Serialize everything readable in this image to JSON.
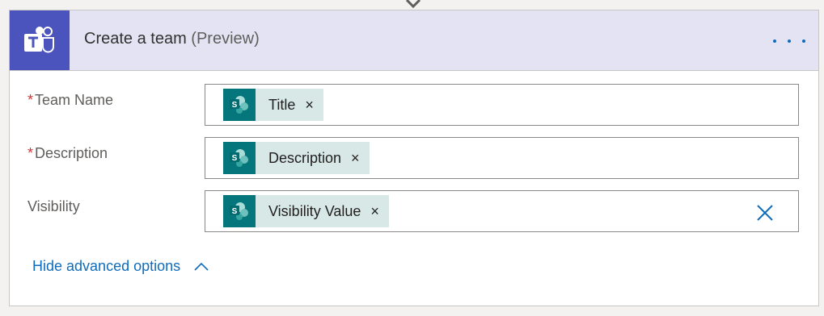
{
  "card": {
    "title": "Create a team",
    "title_suffix": "(Preview)",
    "app_icon": "microsoft-teams-icon",
    "more_icon": "more-options-icon"
  },
  "fields": [
    {
      "label": "Team Name",
      "required": true,
      "token": "Title",
      "token_icon": "sharepoint-icon",
      "remove_glyph": "×"
    },
    {
      "label": "Description",
      "required": true,
      "token": "Description",
      "token_icon": "sharepoint-icon",
      "remove_glyph": "×"
    },
    {
      "label": "Visibility",
      "required": false,
      "token": "Visibility Value",
      "token_icon": "sharepoint-icon",
      "remove_glyph": "×",
      "clear_icon": "clear-x-icon"
    }
  ],
  "required_marker": "*",
  "advanced": {
    "label": "Hide advanced options",
    "icon": "chevron-up-icon"
  },
  "colors": {
    "header_bg": "#e3e3f3",
    "teams_purple": "#4b53bc",
    "sharepoint_teal": "#05767b",
    "token_bg": "#d7e8e7",
    "link_blue": "#0f6cbd",
    "required_red": "#d13438"
  }
}
